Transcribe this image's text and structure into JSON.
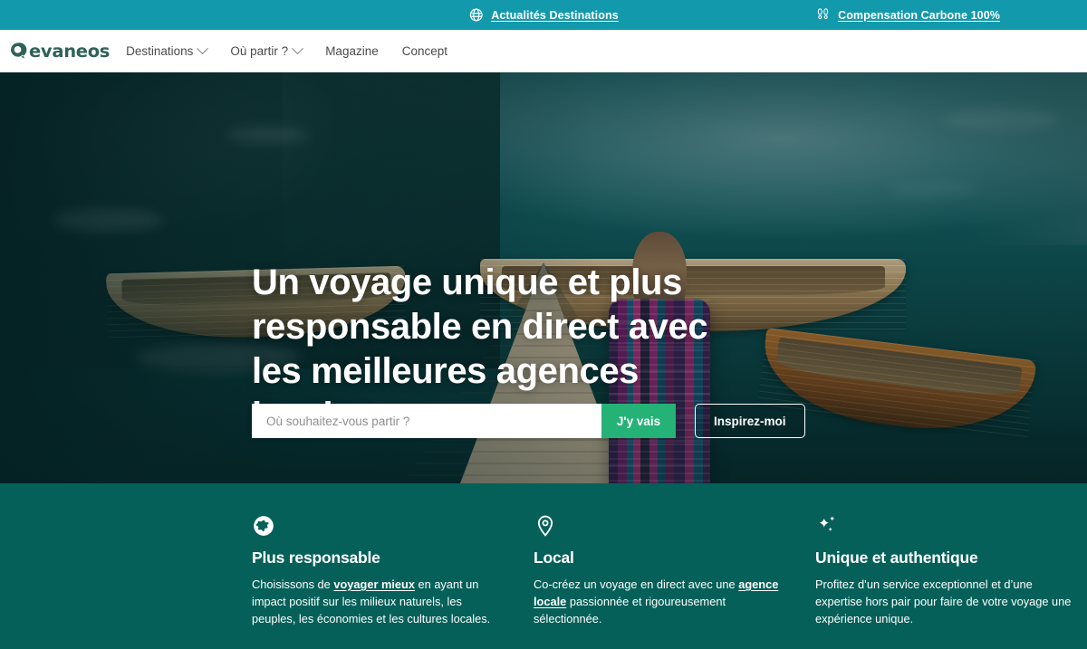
{
  "promo_bar": {
    "left": {
      "icon": "globe-icon",
      "label": "Actualités Destinations"
    },
    "right": {
      "icon": "footprints-icon",
      "label": "Compensation Carbone 100%"
    },
    "bg_color": "#1399ac"
  },
  "navbar": {
    "logo": {
      "icon": "evaneos-logo-mark",
      "text": "evaneos",
      "color": "#2f6257"
    },
    "items": [
      {
        "label": "Destinations",
        "has_chevron": true
      },
      {
        "label": "Où partir ?",
        "has_chevron": true
      },
      {
        "label": "Magazine",
        "has_chevron": false
      },
      {
        "label": "Concept",
        "has_chevron": false
      }
    ]
  },
  "hero": {
    "title": "Un voyage unique et plus responsable en direct avec les meilleures agences locales",
    "search": {
      "placeholder": "Où souhaitez-vous partir ?",
      "value": "",
      "submit_label": "J'y vais",
      "submit_color": "#25b277"
    },
    "secondary_button": "Inspirez-moi",
    "image_description": "Femme de dos marchant sur un ponton en bois vers un lac turquoise avec des barques en bois"
  },
  "features": {
    "bg_color": "#056059",
    "items": [
      {
        "icon": "globe-icon",
        "title": "Plus responsable",
        "desc_before": "Choisissons de ",
        "desc_link": "voyager mieux",
        "desc_after": " en ayant un impact positif sur les milieux naturels, les peuples, les économies et les cultures locales."
      },
      {
        "icon": "map-pin-icon",
        "title": "Local",
        "desc_before": "Co-créez un voyage en direct avec une ",
        "desc_link": "agence locale",
        "desc_after": " passionnée et rigoureusement sélectionnée."
      },
      {
        "icon": "sparkles-icon",
        "title": "Unique et authentique",
        "desc_before": "Profitez d’un service exceptionnel et d’une expertise hors pair pour faire de votre voyage une expérience unique.",
        "desc_link": "",
        "desc_after": ""
      }
    ]
  }
}
